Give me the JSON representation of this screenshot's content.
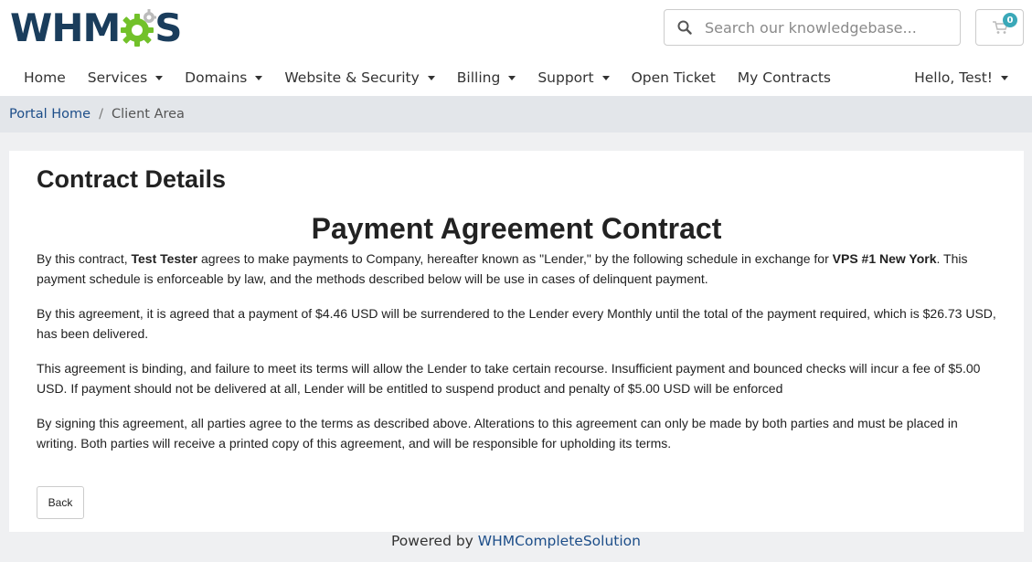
{
  "brand": {
    "logo_prefix": "WHM",
    "logo_suffix": "S",
    "logo_dark": "#1a3d5c",
    "logo_green": "#72c12a"
  },
  "search": {
    "placeholder": "Search our knowledgebase...",
    "icon": "search-icon"
  },
  "cart": {
    "count": "0",
    "icon": "shopping-cart-icon",
    "badge_color": "#3aa8b8"
  },
  "nav": {
    "items": [
      {
        "label": "Home",
        "dropdown": false
      },
      {
        "label": "Services",
        "dropdown": true
      },
      {
        "label": "Domains",
        "dropdown": true
      },
      {
        "label": "Website & Security",
        "dropdown": true
      },
      {
        "label": "Billing",
        "dropdown": true
      },
      {
        "label": "Support",
        "dropdown": true
      },
      {
        "label": "Open Ticket",
        "dropdown": false
      },
      {
        "label": "My Contracts",
        "dropdown": false
      }
    ],
    "account_label": "Hello, Test!"
  },
  "breadcrumb": {
    "home": "Portal Home",
    "separator": "/",
    "current": "Client Area"
  },
  "card": {
    "title": "Contract Details",
    "contract_heading": "Payment Agreement Contract",
    "p1_a": "By this contract, ",
    "p1_name": "Test Tester",
    "p1_b": " agrees to make payments to Company, hereafter known as \"Lender,\" by the following schedule in exchange for ",
    "p1_product": "VPS #1 New York",
    "p1_c": ". This payment schedule is enforceable by law, and the methods described below will be use in cases of delinquent payment.",
    "p2": "By this agreement, it is agreed that a payment of $4.46 USD will be surrendered to the Lender every Monthly until the total of the payment required, which is $26.73 USD, has been delivered.",
    "p3": "This agreement is binding, and failure to meet its terms will allow the Lender to take certain recourse. Insufficient payment and bounced checks will incur a fee of $5.00 USD. If payment should not be delivered at all, Lender will be entitled to suspend product and penalty of $5.00 USD will be enforced",
    "p4": "By signing this agreement, all parties agree to the terms as described above. Alterations to this agreement can only be made by both parties and must be placed in writing. Both parties will receive a printed copy of this agreement, and will be responsible for upholding its terms.",
    "back_label": "Back"
  },
  "footer": {
    "prefix": "Powered by ",
    "link": "WHMCompleteSolution",
    "link_color": "#1d4e89"
  }
}
